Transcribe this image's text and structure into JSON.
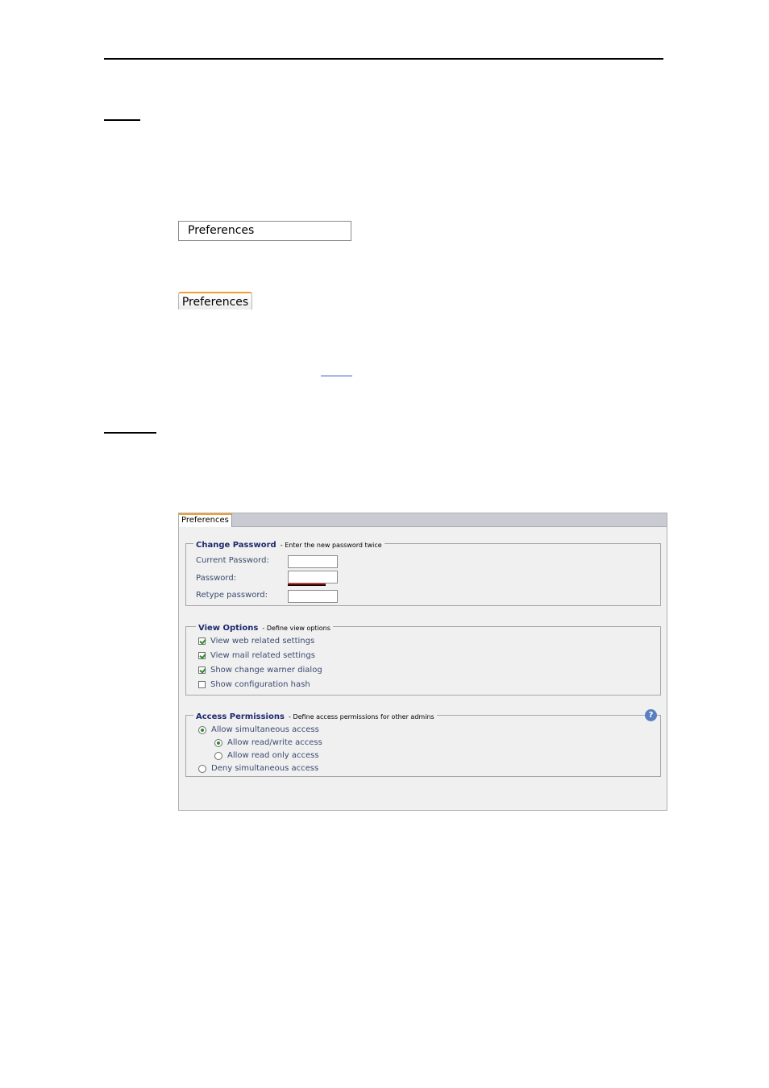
{
  "doc": {
    "preferences_button_label": "Preferences",
    "preferences_tab_label": "Preferences"
  },
  "screenshot": {
    "tab_label": "Preferences",
    "change_password": {
      "title": "Change Password",
      "subtitle": "- Enter the new password twice",
      "current_password_label": "Current Password:",
      "password_label": "Password:",
      "retype_password_label": "Retype password:",
      "current_password_value": "",
      "password_value": "",
      "retype_password_value": ""
    },
    "view_options": {
      "title": "View Options",
      "subtitle": "- Define view options",
      "items": [
        {
          "label": "View web related settings",
          "checked": true
        },
        {
          "label": "View mail related settings",
          "checked": true
        },
        {
          "label": "Show change warner dialog",
          "checked": true
        },
        {
          "label": "Show configuration hash",
          "checked": false
        }
      ]
    },
    "access_permissions": {
      "title": "Access Permissions",
      "subtitle": "- Define access permissions for other admins",
      "allow_label": "Allow simultaneous access",
      "readwrite_label": "Allow read/write access",
      "readonly_label": "Allow read only access",
      "deny_label": "Deny simultaneous access",
      "selected": "Allow simultaneous access",
      "sub_selected": "Allow read/write access"
    }
  },
  "colors": {
    "accent_tab": "#f0a030",
    "legend_title": "#1e2a6e",
    "checkmark": "#2f8a2f",
    "help_icon": "#5a7fc0"
  }
}
